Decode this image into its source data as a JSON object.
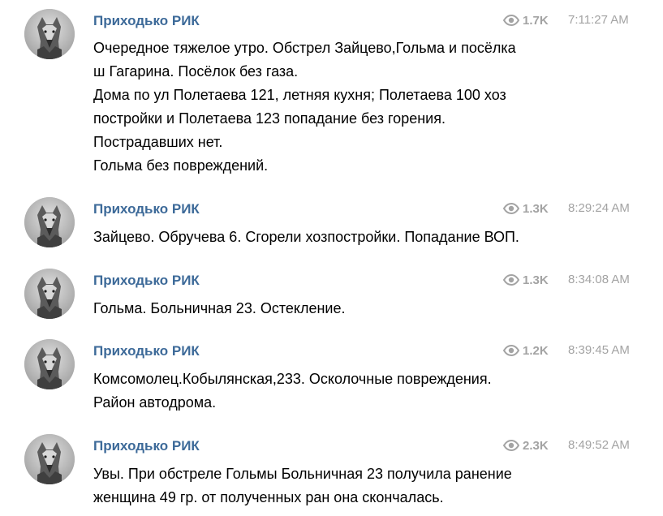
{
  "messages": [
    {
      "author": "Приходько РИК",
      "avatar_icon": "wolf-avatar",
      "views": "1.7K",
      "time": "7:11:27 AM",
      "lines": [
        "Очередное тяжелое утро. Обстрел Зайцево,Гольма и посёлка",
        "ш Гагарина. Посёлок без газа.",
        "Дома по ул Полетаева 121, летняя кухня; Полетаева 100 хоз",
        "постройки и Полетаева 123 попадание без горения.",
        "Пострадавших нет.",
        "Гольма без повреждений."
      ]
    },
    {
      "author": "Приходько РИК",
      "avatar_icon": "wolf-avatar",
      "views": "1.3K",
      "time": "8:29:24 AM",
      "lines": [
        "Зайцево. Обручева 6. Сгорели хозпостройки. Попадание ВОП."
      ]
    },
    {
      "author": "Приходько РИК",
      "avatar_icon": "wolf-avatar",
      "views": "1.3K",
      "time": "8:34:08 AM",
      "lines": [
        "Гольма. Больничная 23. Остекление."
      ]
    },
    {
      "author": "Приходько РИК",
      "avatar_icon": "wolf-avatar",
      "views": "1.2K",
      "time": "8:39:45 AM",
      "lines": [
        "Комсомолец.Кобылянская,233. Осколочные повреждения.",
        "Район автодрома."
      ]
    },
    {
      "author": "Приходько РИК",
      "avatar_icon": "wolf-avatar",
      "views": "2.3K",
      "time": "8:49:52 AM",
      "lines": [
        "Увы. При обстреле Гольмы Больничная 23 получила ранение",
        "женщина 49 гр. от полученных ран она скончалась."
      ]
    }
  ],
  "colors": {
    "author": "#3d6a99",
    "meta": "#a3a3a3",
    "text": "#000000"
  },
  "icons": {
    "views": "eye-icon"
  }
}
